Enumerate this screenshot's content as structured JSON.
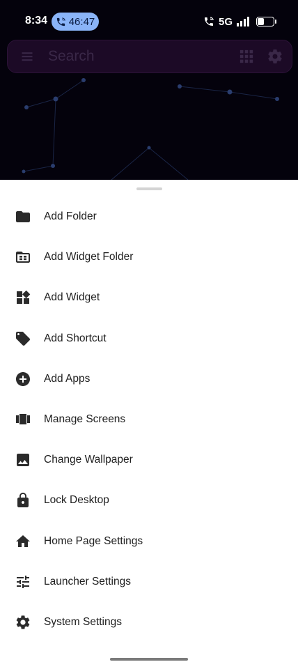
{
  "status_bar": {
    "time": "8:34",
    "call_timer": "46:47",
    "network": "5G",
    "call_pill_color": "#8ab4f8"
  },
  "search_bar": {
    "label": "Search",
    "left_icon": "menu-icon",
    "right_icons": [
      "apps-grid-icon",
      "gear-icon"
    ]
  },
  "menu": {
    "items": [
      {
        "label": "Add Folder",
        "icon": "folder-icon"
      },
      {
        "label": "Add Widget Folder",
        "icon": "widget-folder-icon"
      },
      {
        "label": "Add Widget",
        "icon": "widgets-icon"
      },
      {
        "label": "Add Shortcut",
        "icon": "tag-icon"
      },
      {
        "label": "Add Apps",
        "icon": "add-circle-icon"
      },
      {
        "label": "Manage Screens",
        "icon": "view-carousel-icon"
      },
      {
        "label": "Change Wallpaper",
        "icon": "image-icon"
      },
      {
        "label": "Lock Desktop",
        "icon": "lock-icon"
      },
      {
        "label": "Home Page Settings",
        "icon": "home-icon"
      },
      {
        "label": "Launcher Settings",
        "icon": "tune-icon"
      },
      {
        "label": "System Settings",
        "icon": "gear-icon"
      }
    ]
  },
  "colors": {
    "sheet_background": "#ffffff",
    "icon_color": "#2b2b2b",
    "backdrop": "#04020c"
  }
}
